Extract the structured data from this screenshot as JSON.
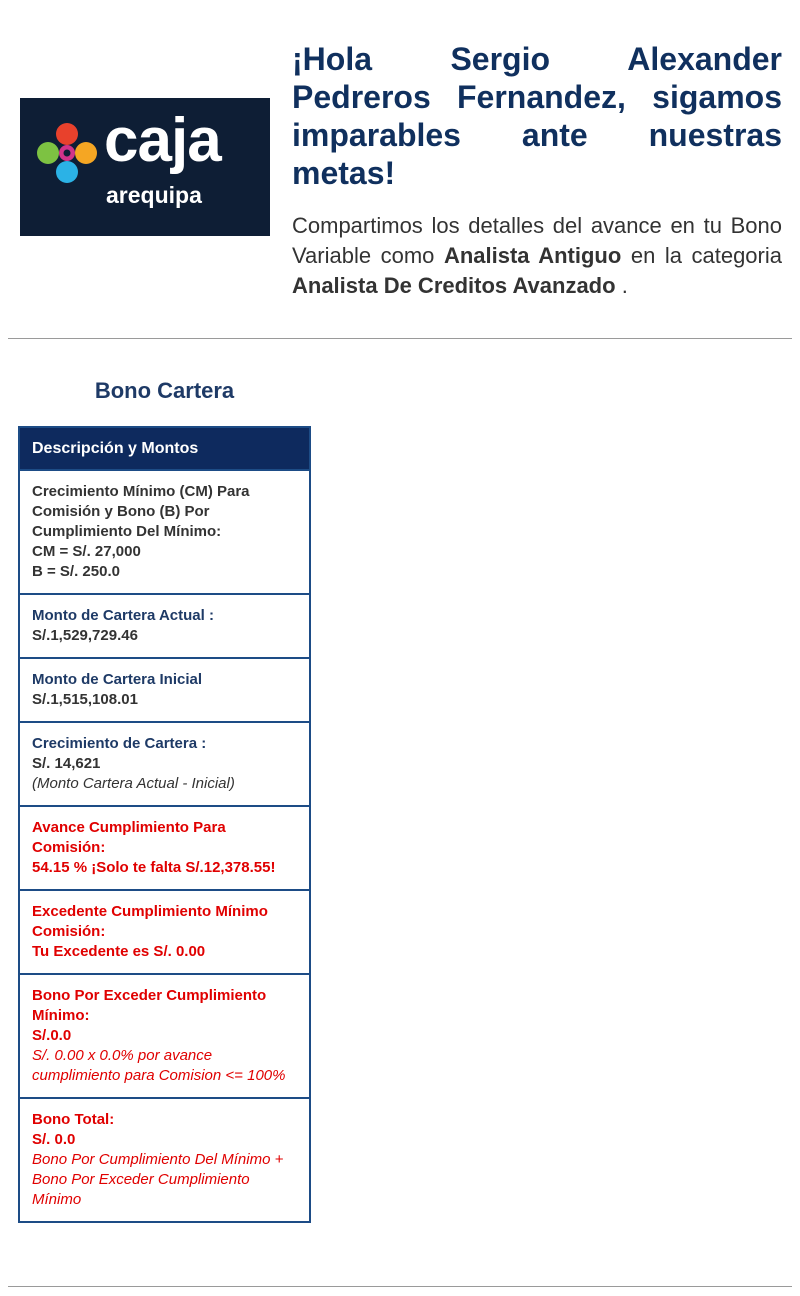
{
  "header": {
    "logo": {
      "wordmark": "caja",
      "subtitle": "arequipa",
      "background": "#0e1e35"
    },
    "greeting": "¡Hola Sergio Alexander Pedreros Fernandez, sigamos imparables ante nuestras metas!",
    "intro": {
      "text_1": "Compartimos los detalles del avance en tu Bono Variable como",
      "role": "Analista Antiguo",
      "text_2": "en la categoria",
      "category": "Analista De Creditos Avanzado",
      "text_3": "."
    }
  },
  "section": {
    "title": "Bono Cartera"
  },
  "table": {
    "header": "Descripción y Montos",
    "crecimiento_minimo": {
      "label": "Crecimiento Mínimo (CM) Para Comisión y Bono (B) Por Cumplimiento Del Mínimo:",
      "cm": "CM = S/. 27,000",
      "b": "B = S/. 250.0"
    },
    "cartera_actual": {
      "label": "Monto de Cartera Actual :",
      "value": "S/.1,529,729.46"
    },
    "cartera_inicial": {
      "label": "Monto de Cartera Inicial",
      "value": "S/.1,515,108.01"
    },
    "crecimiento_cartera": {
      "label": "Crecimiento de Cartera :",
      "value": "S/. 14,621",
      "note": "(Monto Cartera Actual - Inicial)"
    },
    "avance": {
      "label": "Avance Cumplimiento Para Comisión:",
      "value": "54.15 % ¡Solo te falta S/.12,378.55!"
    },
    "excedente": {
      "label": "Excedente Cumplimiento Mínimo Comisión:",
      "value": "Tu Excedente es S/. 0.00"
    },
    "bono_exceder": {
      "label": "Bono Por Exceder Cumplimiento Mínimo:",
      "value": "S/.0.0",
      "note": "S/. 0.00 x 0.0% por avance cumplimiento para Comision <= 100%"
    },
    "bono_total": {
      "label": "Bono Total:",
      "value": "S/. 0.0",
      "note": "Bono Por Cumplimiento Del Mínimo + Bono Por Exceder Cumplimiento Mínimo"
    }
  },
  "colors": {
    "navy": "#10305e",
    "header_bg": "#0e2a5e",
    "border": "#1d4c86",
    "red": "#e00000"
  }
}
